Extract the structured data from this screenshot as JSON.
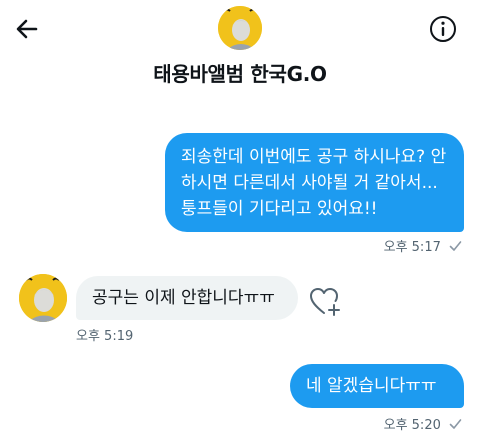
{
  "header": {
    "title": "태용바앨범 한국G.O",
    "back_icon": "arrow-left-icon",
    "info_icon": "info-circle-icon"
  },
  "messages": [
    {
      "direction": "outgoing",
      "text": "죄송한데 이번에도 공구 하시나요? 안하시면 다른데서 사야될 거 같아서...퉁프들이 기다리고 있어요!!",
      "time": "오후 5:17",
      "status_icon": "sent-check-icon"
    },
    {
      "direction": "incoming",
      "text": "공구는 이제 안합니다ㅠㅠ",
      "time": "오후 5:19",
      "reaction_icon": "heart-plus-icon"
    },
    {
      "direction": "outgoing",
      "text": "네 알겠습니다ㅠㅠ",
      "time": "오후 5:20",
      "status_icon": "sent-check-icon"
    }
  ],
  "colors": {
    "accent": "#1d9bf0",
    "incoming_bubble": "#eff3f4",
    "meta_text": "#536471",
    "avatar_bg": "#f1c21b"
  }
}
